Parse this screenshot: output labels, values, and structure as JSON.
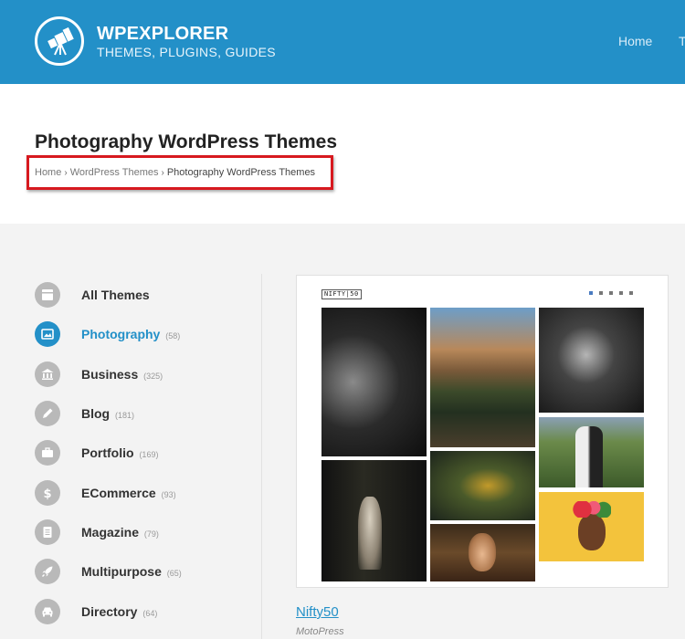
{
  "header": {
    "brand_name": "WPEXPLORER",
    "tagline": "THEMES, PLUGINS, GUIDES",
    "nav": [
      "Home",
      "T"
    ],
    "bg_color": "#2390c8"
  },
  "page": {
    "title": "Photography WordPress Themes",
    "breadcrumb": [
      "Home",
      "WordPress Themes",
      "Photography WordPress Themes"
    ],
    "breadcrumb_separator": "›",
    "highlight_color": "#d7191f"
  },
  "sidebar": {
    "categories": [
      {
        "label": "All Themes",
        "count": "",
        "icon": "grid-icon",
        "active": false
      },
      {
        "label": "Photography",
        "count": "(58)",
        "icon": "image-icon",
        "active": true
      },
      {
        "label": "Business",
        "count": "(325)",
        "icon": "bank-icon",
        "active": false
      },
      {
        "label": "Blog",
        "count": "(181)",
        "icon": "pencil-icon",
        "active": false
      },
      {
        "label": "Portfolio",
        "count": "(169)",
        "icon": "briefcase-icon",
        "active": false
      },
      {
        "label": "ECommerce",
        "count": "(93)",
        "icon": "dollar-icon",
        "active": false
      },
      {
        "label": "Magazine",
        "count": "(79)",
        "icon": "document-icon",
        "active": false
      },
      {
        "label": "Multipurpose",
        "count": "(65)",
        "icon": "rocket-icon",
        "active": false
      },
      {
        "label": "Directory",
        "count": "(64)",
        "icon": "car-icon",
        "active": false
      }
    ]
  },
  "theme_card": {
    "preview_logo": "NIFTY|50",
    "name": "Nifty50",
    "author": "MotoPress"
  }
}
